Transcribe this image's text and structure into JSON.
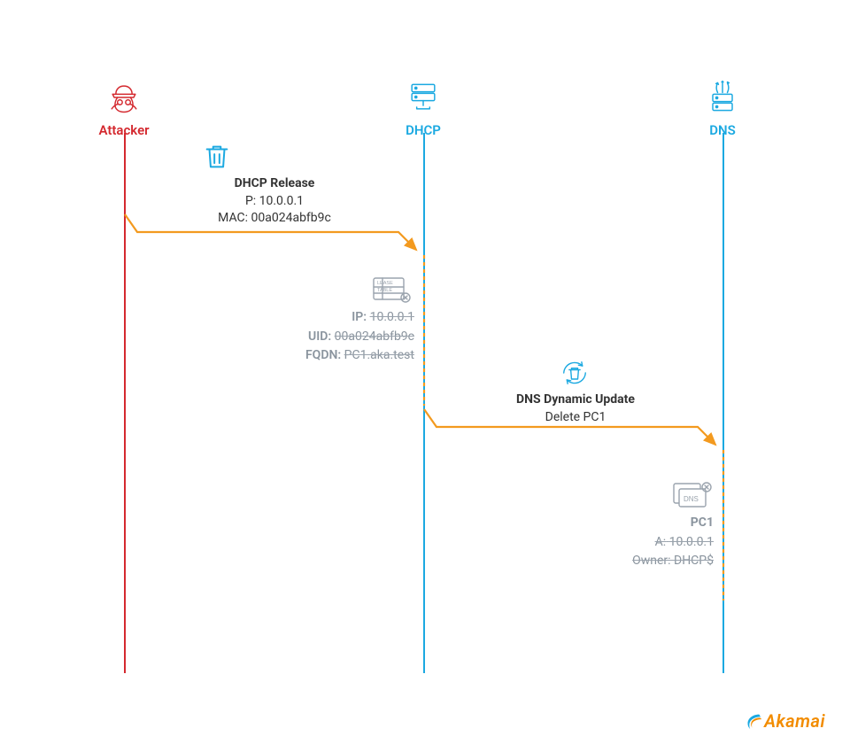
{
  "actors": {
    "attacker": "Attacker",
    "dhcp": "DHCP",
    "dns": "DNS"
  },
  "msg1": {
    "title": "DHCP Release",
    "line1": "P: 10.0.0.1",
    "line2": "MAC: 00a024abfb9c"
  },
  "lease": {
    "ip_label": "IP:",
    "ip_value": "10.0.0.1",
    "uid_label": "UID:",
    "uid_value": "00a024abfb9c",
    "fqdn_label": "FQDN:",
    "fqdn_value": "PC1.aka.test"
  },
  "msg2": {
    "title": "DNS Dynamic Update",
    "line1": "Delete PC1"
  },
  "dnsrec": {
    "host": "PC1",
    "a_label": "A:",
    "a_value": "10.0.0.1",
    "owner_label": "Owner:",
    "owner_value": "DHCP$"
  },
  "brand": "Akamai"
}
